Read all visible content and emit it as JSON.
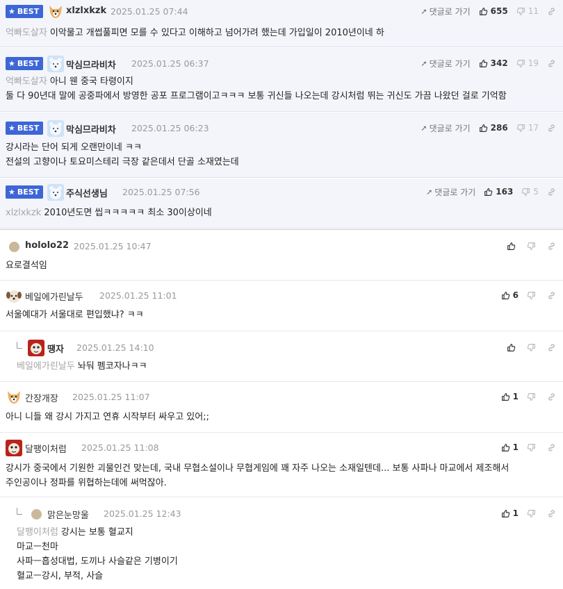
{
  "labels": {
    "best": "BEST",
    "goto": "댓글로 가기"
  },
  "comments": [
    {
      "nick": "xlzlxkzk",
      "date": "2025.01.25 07:44",
      "up": "655",
      "down": "11",
      "mention": "억빠도살자",
      "lines": [
        "이악물고 개썹풀피면 모를 수 있다고 이해하고 넘어가려 했는데 가입일이 2010년이네 하"
      ]
    },
    {
      "nick": "막심므라비차",
      "date": "2025.01.25 06:37",
      "up": "342",
      "down": "19",
      "mention": "억빠도살자",
      "lines": [
        "아니 웬 중국 타령이지",
        "둘 다 90년대 말에 공중파에서 방영한 공포 프로그램이고ㅋㅋㅋ 보통 귀신들 나오는데 강시처럼 뛰는 귀신도 가끔 나왔던 걸로 기억함"
      ]
    },
    {
      "nick": "막심므라비차",
      "date": "2025.01.25 06:23",
      "up": "286",
      "down": "17",
      "lines": [
        "강시라는 단어 되게 오랜만이네 ㅋㅋ",
        "전설의 고향이나 토요미스테리 극장 같은데서 단골 소재였는데"
      ]
    },
    {
      "nick": "주식선생님",
      "date": "2025.01.25 07:56",
      "up": "163",
      "down": "5",
      "mention": "xlzlxkzk",
      "lines": [
        "2010년도면 씹ㅋㅋㅋㅋㅋ 최소 30이상이네"
      ]
    },
    {
      "nick": "hololo22",
      "date": "2025.01.25 10:47",
      "lines": [
        "요로결석임"
      ]
    },
    {
      "nick": "베일에가린날두",
      "date": "2025.01.25 11:01",
      "up": "6",
      "lines": [
        "서울예대가 서울대로 편입했냐? ㅋㅋ"
      ]
    },
    {
      "nick": "땡자",
      "date": "2025.01.25 14:10",
      "mention": "베일에가린날두",
      "lines": [
        "놔둬 펨코자나ㅋㅋ"
      ]
    },
    {
      "nick": "간장개장",
      "date": "2025.01.25 11:07",
      "up": "1",
      "lines": [
        "아니 니들 왜 강시 가지고 연휴 시작부터 싸우고 있어;;"
      ]
    },
    {
      "nick": "달팽이처럼",
      "date": "2025.01.25 11:08",
      "up": "1",
      "lines": [
        "강시가 중국에서 기원한 괴물인건 맞는데, 국내 무협소설이나 무협게임에 꽤 자주 나오는 소재일텐데... 보통 사파나 마교에서 제조해서",
        "주인공이나 정파를 위협하는데에 써먹잖아."
      ]
    },
    {
      "nick": "맑은눈망울",
      "date": "2025.01.25 12:43",
      "up": "1",
      "mention": "달팽이처럼",
      "lines": [
        "강시는 보통 혈교지",
        "마교ㅡ천마",
        "사파ㅡ흡성대법, 도끼나 사슬같은 기병이기",
        "혈교ㅡ강시, 부적, 사슬"
      ]
    }
  ]
}
